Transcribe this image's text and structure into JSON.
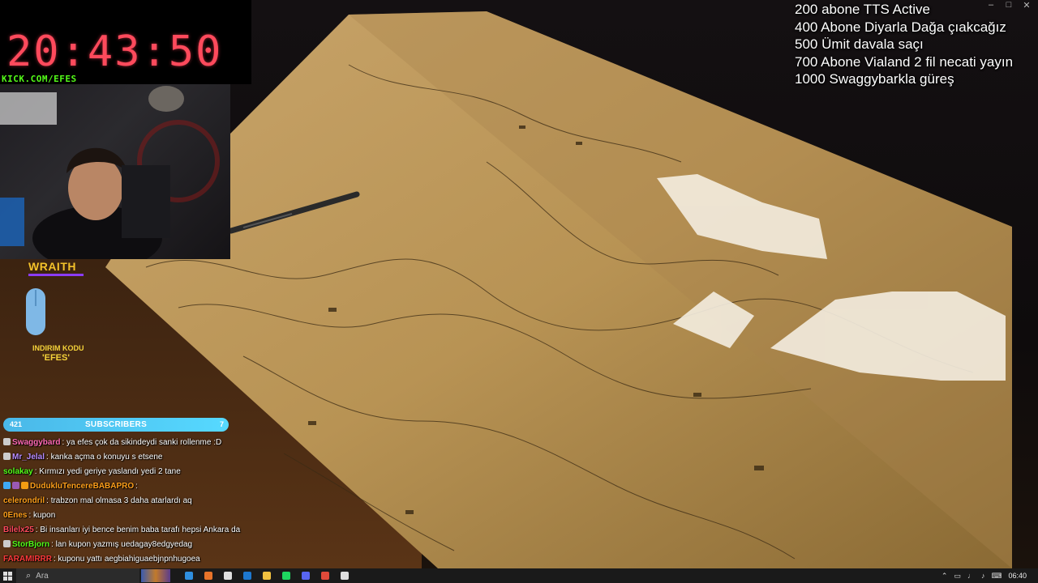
{
  "timer": {
    "time": "20:43:50",
    "link": "KICK.COM/EFES"
  },
  "brand": {
    "name": "WRAITH",
    "promo_label": "INDIRIM KODU",
    "promo_code": "'EFES'"
  },
  "subscribers": {
    "count": "421",
    "label": "SUBSCRIBERS",
    "goal_marker": "7"
  },
  "goals": [
    "200 abone TTS Active",
    "400 Abone Diyarla Dağa çıakcağız",
    "500 Ümit davala saçı",
    "700 Abone Vialand 2 fil necati yayın",
    "1000 Swaggybarkla güreş"
  ],
  "chat": [
    {
      "user": "Swaggybard",
      "color": "#ff69b4",
      "badges": [
        "#cccccc"
      ],
      "message": ": ya efes çok da sikindeydi sanki rollenme :D"
    },
    {
      "user": "Mr_Jelal",
      "color": "#b98cff",
      "badges": [
        "#cccccc"
      ],
      "message": ": kanka açma o konuyu s etsene"
    },
    {
      "user": "solakay",
      "color": "#53fc18",
      "badges": [],
      "message": ": Kırmızı yedi geriye yaslandı yedi 2 tane"
    },
    {
      "user": "DudukluTencereBABAPRO",
      "color": "#ff9f1a",
      "badges": [
        "#3fa9f5",
        "#9b59b6",
        "#f39c12"
      ],
      "message": ":"
    },
    {
      "user": "celerondril",
      "color": "#ff9f1a",
      "badges": [],
      "message": ": trabzon mal olmasa 3 daha atarlardı aq"
    },
    {
      "user": "0Enes",
      "color": "#ff9f1a",
      "badges": [],
      "message": ": kupon"
    },
    {
      "user": "Bilelx25",
      "color": "#ff4a5c",
      "badges": [],
      "message": ": Bi insanları iyi bence benim baba tarafı hepsi Ankara da"
    },
    {
      "user": "StorBjorn",
      "color": "#53fc18",
      "badges": [
        "#cccccc"
      ],
      "message": ": lan kupon yazmış uedagay8edgyedag"
    },
    {
      "user": "FARAMIRRR",
      "color": "#ff3b3b",
      "badges": [],
      "message": ": kuponu yattı aegbiahiguaebjnpnhugoea"
    }
  ],
  "taskbar": {
    "search_placeholder": "Ara",
    "apps": [
      {
        "name": "edge",
        "color": "#2f8fe0"
      },
      {
        "name": "firefox",
        "color": "#e8742a"
      },
      {
        "name": "calendar",
        "color": "#e0e0e0"
      },
      {
        "name": "outlook",
        "color": "#1d78d0"
      },
      {
        "name": "files",
        "color": "#f0c040"
      },
      {
        "name": "spotify",
        "color": "#1ed760"
      },
      {
        "name": "discord",
        "color": "#5865f2"
      },
      {
        "name": "chrome",
        "color": "#e04a3a"
      },
      {
        "name": "obs",
        "color": "#dddddd"
      }
    ],
    "clock": "06:40"
  }
}
